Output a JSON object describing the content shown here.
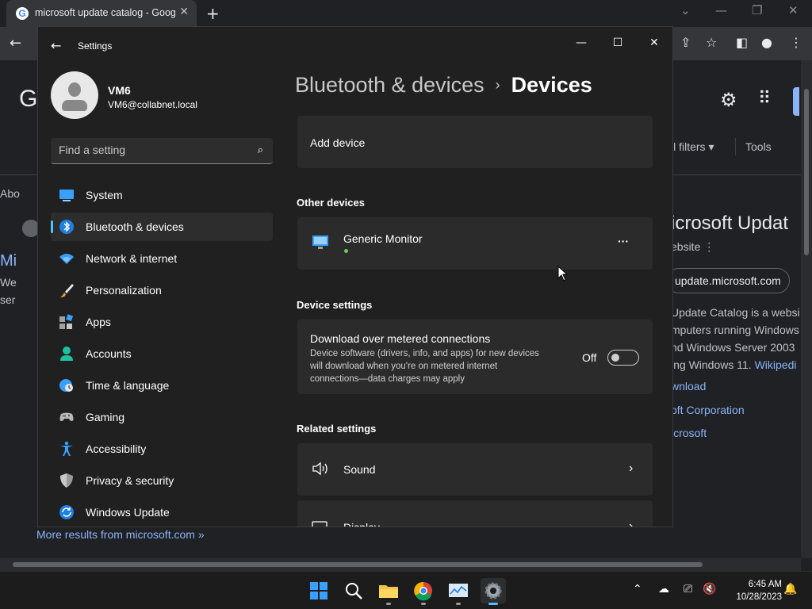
{
  "browser": {
    "tab_title": "microsoft update catalog - Goog",
    "tab_favicon": "G",
    "close_tab": "✕",
    "new_tab": "+",
    "page": {
      "logo_letter": "G",
      "all_filters": "ll filters ▾",
      "tools": "Tools",
      "left_fragments": [
        "Abo",
        "Mi",
        "We",
        "ser"
      ],
      "more_results": "More results from microsoft.com »",
      "knowledge_panel": {
        "title": "icrosoft Updat",
        "subtitle": "ebsite  ⋮",
        "chip": "update.microsoft.com",
        "desc_lines": [
          "Update Catalog is a websi",
          "mputers running Windows",
          "nd Windows Server 2003",
          "ing Windows 11."
        ],
        "wiki": "Wikipedi",
        "links": [
          "wnload",
          "oft Corporation",
          "icrosoft"
        ]
      }
    }
  },
  "settings": {
    "window_title": "Settings",
    "user": {
      "name": "VM6",
      "email": "VM6@collabnet.local"
    },
    "search_placeholder": "Find a setting",
    "nav": [
      {
        "label": "System",
        "icon": "system-icon",
        "active": false
      },
      {
        "label": "Bluetooth & devices",
        "icon": "bluetooth-icon",
        "active": true
      },
      {
        "label": "Network & internet",
        "icon": "wifi-icon",
        "active": false
      },
      {
        "label": "Personalization",
        "icon": "brush-icon",
        "active": false
      },
      {
        "label": "Apps",
        "icon": "apps-icon",
        "active": false
      },
      {
        "label": "Accounts",
        "icon": "accounts-icon",
        "active": false
      },
      {
        "label": "Time & language",
        "icon": "time-language-icon",
        "active": false
      },
      {
        "label": "Gaming",
        "icon": "gaming-icon",
        "active": false
      },
      {
        "label": "Accessibility",
        "icon": "accessibility-icon",
        "active": false
      },
      {
        "label": "Privacy & security",
        "icon": "shield-icon",
        "active": false
      },
      {
        "label": "Windows Update",
        "icon": "update-icon",
        "active": false
      }
    ],
    "breadcrumb": {
      "parent": "Bluetooth & devices",
      "separator": "›",
      "current": "Devices"
    },
    "add_device": "Add device",
    "other_devices": {
      "header": "Other devices",
      "device_name": "Generic Monitor",
      "more": "···",
      "status_color": "#6ccb5f"
    },
    "device_settings": {
      "header": "Device settings",
      "metered_title": "Download over metered connections",
      "metered_desc_lines": [
        "Device software (drivers, info, and apps) for new devices",
        "will download when you're on metered internet",
        "connections—data charges may apply"
      ],
      "toggle_state": "Off"
    },
    "related": {
      "header": "Related settings",
      "sound": "Sound",
      "display": "Display"
    },
    "accent": "#4cc2ff"
  },
  "taskbar": {
    "time": "6:45 AM",
    "date": "10/28/2023"
  }
}
